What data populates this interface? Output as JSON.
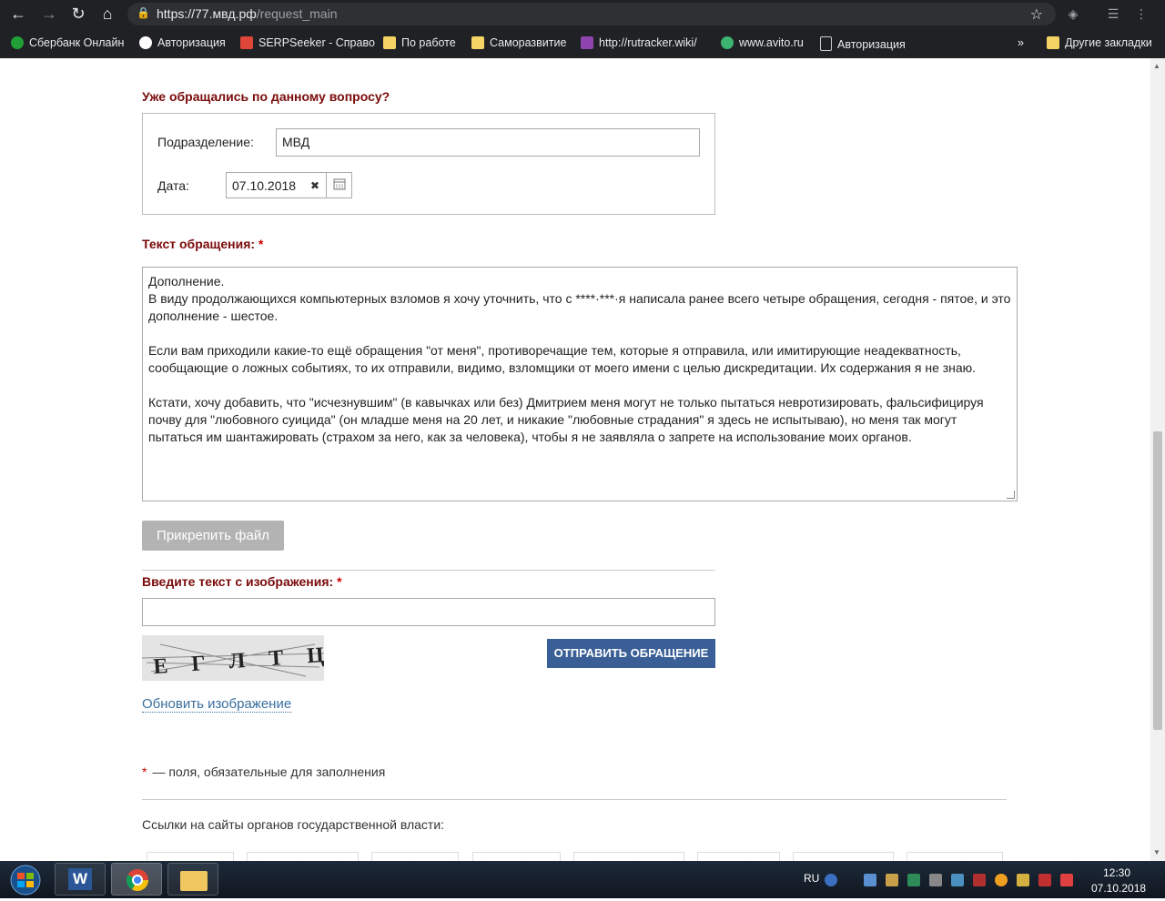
{
  "browser": {
    "url_host": "https://77.мвд.рф",
    "url_path": "/request_main",
    "bookmarks": [
      {
        "label": "Сбербанк Онлайн",
        "color": "#21a038"
      },
      {
        "label": "Авторизация",
        "color": "#ffffff"
      },
      {
        "label": "SERPSeeker - Справо",
        "color": "#e0453a"
      },
      {
        "label": "По работе",
        "color": "#f6d365"
      },
      {
        "label": "Саморазвитие",
        "color": "#f6d365"
      },
      {
        "label": "http://rutracker.wiki/",
        "color": "#8e44ad"
      },
      {
        "label": "www.avito.ru",
        "color": "#3cb371"
      },
      {
        "label": "Авторизация",
        "color": "#cccccc"
      }
    ],
    "more": "»",
    "other_bookmarks": "Другие закладки"
  },
  "form": {
    "previous_title": "Уже обращались по данному вопросу?",
    "department_label": "Подразделение:",
    "department_value": "МВД",
    "date_label": "Дата:",
    "date_value": "07.10.2018",
    "text_title": "Текст обращения:",
    "required_mark": "*",
    "appeal_paragraphs": [
      "Дополнение.",
      "В виду продолжающихся компьютерных взломов я хочу уточнить, что с  ****·***·я написала ранее всего четыре обращения, сегодня - пятое, и это дополнение - шестое.",
      "",
      "Если вам приходили какие-то ещё обращения \"от меня\", противоречащие тем, которые я отправила, или имитирующие неадекватность, сообщающие о ложных событиях, то их отправили, видимо, взломщики от моего имени с целью дискредитации. Их содержания я не знаю.",
      "",
      "Кстати, хочу добавить, что \"исчезнувшим\" (в кавычках или без) Дмитрием меня могут не только пытаться невротизировать, фальсифицируя почву для \"любовного суицида\" (он младше меня на 20 лет, и никакие \"любовные страдания\" я здесь не испытываю), но меня так могут пытаться им шантажировать (страхом за него, как за человека), чтобы я не заявляла о запрете на использование моих органов."
    ],
    "attach_button": "Прикрепить файл",
    "captcha_title": "Введите текст с изображения:",
    "captcha_letters": "Е Г Л Т Ц",
    "submit_button": "ОТПРАВИТЬ ОБРАЩЕНИЕ",
    "refresh_link": "Обновить изображение",
    "required_note": "— поля, обязательные для заполнения",
    "links_title": "Ссылки на сайты органов государственной власти:"
  },
  "taskbar": {
    "lang": "RU",
    "time": "12:30",
    "date": "07.10.2018"
  }
}
